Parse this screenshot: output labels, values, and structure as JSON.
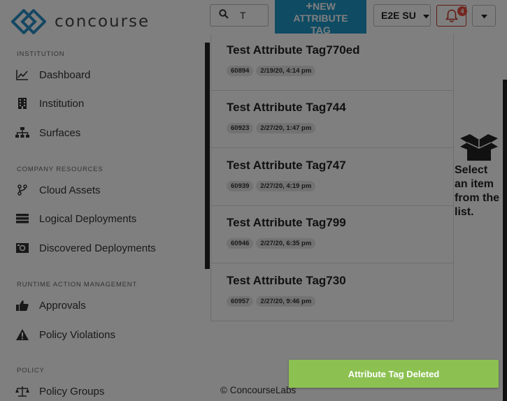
{
  "brand": {
    "name": "concourse",
    "color": "#2a8fc6"
  },
  "search": {
    "value": "T"
  },
  "header": {
    "new_button_plus": "+",
    "new_button_line1": "NEW",
    "new_button_line2": "ATTRIBUTE",
    "new_button_line3": "TAG",
    "org_label": "E2E SU",
    "notification_count": "4"
  },
  "sidebar": {
    "sections": [
      {
        "title": "INSTITUTION",
        "items": [
          {
            "label": "Dashboard",
            "icon": "chart-icon"
          },
          {
            "label": "Institution",
            "icon": "building-icon"
          },
          {
            "label": "Surfaces",
            "icon": "sitemap-icon"
          }
        ]
      },
      {
        "title": "COMPANY RESOURCES",
        "items": [
          {
            "label": "Cloud Assets",
            "icon": "branch-icon"
          },
          {
            "label": "Logical Deployments",
            "icon": "server-icon"
          },
          {
            "label": "Discovered Deployments",
            "icon": "discovered-icon"
          }
        ]
      },
      {
        "title": "RUNTIME ACTION MANAGEMENT",
        "items": [
          {
            "label": "Approvals",
            "icon": "thumbs-up-icon"
          },
          {
            "label": "Policy Violations",
            "icon": "warning-icon"
          }
        ]
      },
      {
        "title": "POLICY",
        "items": [
          {
            "label": "Policy Groups",
            "icon": "scale-icon"
          }
        ]
      }
    ]
  },
  "list": {
    "items": [
      {
        "title": "Test Attribute Tag770ed",
        "id": "60894",
        "date": "2/19/20, 4:14 pm"
      },
      {
        "title": "Test Attribute Tag744",
        "id": "60923",
        "date": "2/27/20, 1:47 pm"
      },
      {
        "title": "Test Attribute Tag747",
        "id": "60939",
        "date": "2/27/20, 4:19 pm"
      },
      {
        "title": "Test Attribute Tag799",
        "id": "60946",
        "date": "2/27/20, 6:35 pm"
      },
      {
        "title": "Test Attribute Tag730",
        "id": "60957",
        "date": "2/27/20, 9:46 pm"
      }
    ]
  },
  "empty_state": {
    "line1": "Select",
    "line2": "an item",
    "line3": "from the",
    "line4": "list."
  },
  "footer": {
    "copyright": "© ConcourseLabs"
  },
  "toast": {
    "message": "Attribute Tag Deleted",
    "color": "#8cc152"
  }
}
